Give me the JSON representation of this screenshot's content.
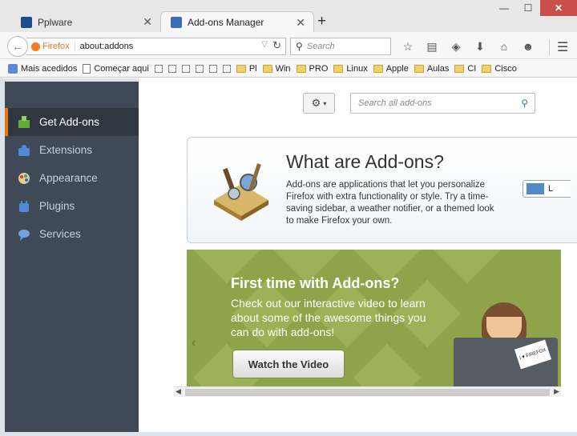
{
  "tabs": [
    {
      "title": "Pplware",
      "icon": "pplware-icon",
      "active": false
    },
    {
      "title": "Add-ons Manager",
      "icon": "puzzle-icon",
      "active": true
    }
  ],
  "navbar": {
    "identity": "Firefox",
    "url": "about:addons",
    "search_placeholder": "Search"
  },
  "bookmarks": [
    {
      "label": "Mais acedidos",
      "type": "mostvisited"
    },
    {
      "label": "Começar aqui",
      "type": "page"
    },
    {
      "label": "",
      "type": "blank"
    },
    {
      "label": "",
      "type": "blank"
    },
    {
      "label": "",
      "type": "blank"
    },
    {
      "label": "",
      "type": "blank"
    },
    {
      "label": "",
      "type": "blank"
    },
    {
      "label": "",
      "type": "blank"
    },
    {
      "label": "Pl",
      "type": "folder"
    },
    {
      "label": "Win",
      "type": "folder"
    },
    {
      "label": "PRO",
      "type": "folder"
    },
    {
      "label": "Linux",
      "type": "folder"
    },
    {
      "label": "Apple",
      "type": "folder"
    },
    {
      "label": "Aulas",
      "type": "folder"
    },
    {
      "label": "CI",
      "type": "folder"
    },
    {
      "label": "Cisco",
      "type": "folder"
    }
  ],
  "sidebar": {
    "items": [
      {
        "label": "Get Add-ons",
        "icon": "get-addons-icon",
        "active": true
      },
      {
        "label": "Extensions",
        "icon": "extensions-icon",
        "active": false
      },
      {
        "label": "Appearance",
        "icon": "appearance-icon",
        "active": false
      },
      {
        "label": "Plugins",
        "icon": "plugins-icon",
        "active": false
      },
      {
        "label": "Services",
        "icon": "services-icon",
        "active": false
      }
    ]
  },
  "main": {
    "search_placeholder": "Search all add-ons",
    "what": {
      "title": "What are Add-ons?",
      "body": "Add-ons are applications that let you personalize Firefox with extra functionality or style. Try a time-saving sidebar, a weather notifier, or a themed look to make Firefox your own.",
      "learn_label": "L"
    },
    "promo": {
      "title": "First time with Add-ons?",
      "body": "Check out our interactive video to learn about some of the awesome things you can do with add-ons!",
      "button": "Watch the Video",
      "sticker": "I ♥ FIREFOX"
    }
  },
  "colors": {
    "accent": "#e8750e",
    "sidebar_bg": "#404a56",
    "promo_bg": "#8ea44a"
  }
}
